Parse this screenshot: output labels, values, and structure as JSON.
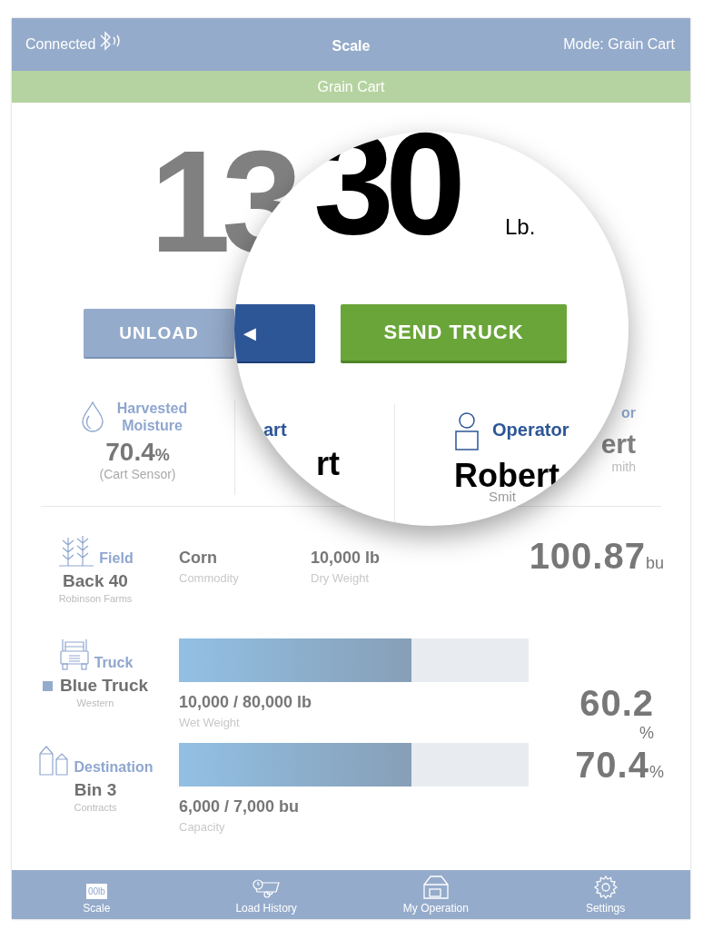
{
  "header": {
    "status": "Connected",
    "title": "Scale",
    "mode": "Mode: Grain Cart"
  },
  "banner": "Grain Cart",
  "weight": {
    "value": "13"
  },
  "buttons": [
    {
      "label": "UNLOAD"
    }
  ],
  "moisture": {
    "label": "Harvested Moisture",
    "value": "70.4",
    "unit": "%",
    "source": "(Cart Sensor)"
  },
  "operator_partial": {
    "label": "or",
    "name": "ert",
    "surname": "mith"
  },
  "rows": [
    {
      "kind": "field",
      "label": "Field",
      "name": "Back 40",
      "sub": "Robinson Farms",
      "stats": [
        {
          "value": "Corn",
          "caption": "Commodity"
        },
        {
          "value": "10,000 lb",
          "caption": "Dry Weight"
        }
      ],
      "total": "100.87",
      "unit": "bu",
      "unit_below": false
    },
    {
      "kind": "truck",
      "label": "Truck",
      "name": "Blue Truck",
      "color": "#95abcb",
      "sub": "Western",
      "level": 0.665,
      "amount": "10,000 / 80,000 lb",
      "caption": "Wet Weight",
      "total": "60.2",
      "unit": "%",
      "unit_below": true
    },
    {
      "kind": "destination",
      "label": "Destination",
      "name": "Bin 3",
      "sub": "Contracts",
      "level": 0.665,
      "amount": "6,000 / 7,000 bu",
      "caption": "Capacity",
      "total": "70.4",
      "unit": "%",
      "unit_below": false
    }
  ],
  "magnifier": {
    "weight": "30",
    "unit": "Lb.",
    "back_button": "◀",
    "send_button": "SEND TRUCK",
    "cart_label": "art",
    "cart_value": "rt",
    "operator_label": "Operator",
    "operator_name": "Robert",
    "operator_surname": "Smit"
  },
  "tabs": [
    {
      "kind": "scale",
      "label": "Scale",
      "icon_text": "00lb"
    },
    {
      "kind": "history",
      "label": "Load History"
    },
    {
      "kind": "operation",
      "label": "My Operation"
    },
    {
      "kind": "settings",
      "label": "Settings"
    }
  ]
}
